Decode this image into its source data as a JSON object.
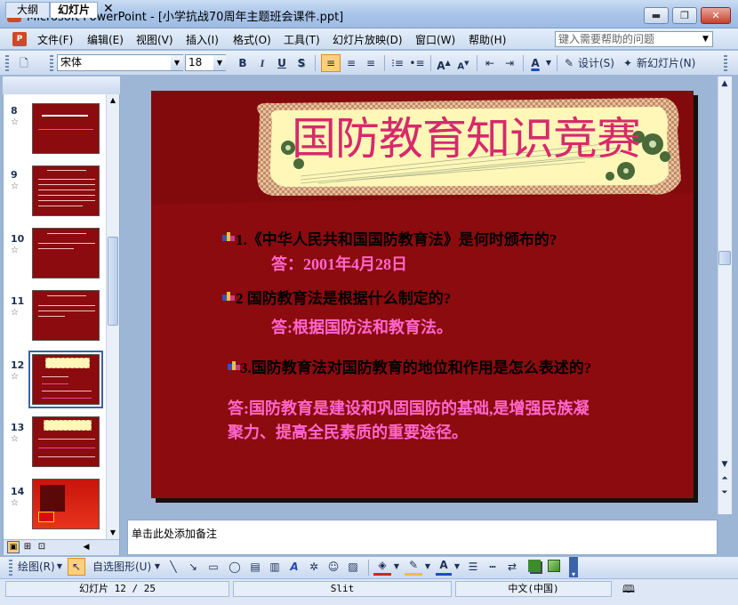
{
  "window": {
    "title": "Microsoft PowerPoint - [小学抗战70周年主题班会课件.ppt]",
    "app_icon": "P",
    "controls": {
      "minimize": "▬",
      "restore": "❐",
      "close": "✕"
    }
  },
  "menu": {
    "items": [
      "文件(F)",
      "编辑(E)",
      "视图(V)",
      "插入(I)",
      "格式(O)",
      "工具(T)",
      "幻灯片放映(D)",
      "窗口(W)",
      "帮助(H)"
    ],
    "help_placeholder": "键入需要帮助的问题"
  },
  "format_toolbar": {
    "font_name": "宋体",
    "font_size": "18",
    "bold": "B",
    "italic": "I",
    "underline": "U",
    "shadow": "S",
    "font_color_glyph": "A",
    "design_label": "设计(S)",
    "new_slide_label": "新幻灯片(N)"
  },
  "left_panel": {
    "tabs": [
      "大纲",
      "幻灯片"
    ],
    "close": "✕",
    "slides": [
      {
        "num": "8"
      },
      {
        "num": "9"
      },
      {
        "num": "10"
      },
      {
        "num": "11"
      },
      {
        "num": "12",
        "selected": true
      },
      {
        "num": "13"
      },
      {
        "num": "14"
      }
    ]
  },
  "slide": {
    "title": "国防教育知识竞赛",
    "q1": "1.《中华人民共和国国防教育法》是何时颁布的?",
    "a1": "答：2001年4月28日",
    "q2": "2 国防教育法是根据什么制定的?",
    "a2": "答:根据国防法和教育法。",
    "q3": "3.国防教育法对国防教育的地位和作用是怎么表述的?",
    "a3_line1": "答:国防教育是建设和巩固国防的基础,是增强民族凝",
    "a3_line2": "聚力、提高全民素质的重要途径。",
    "colors": {
      "background": "#8b0b0e",
      "title": "#d62a6b",
      "answer": "#ff66cc",
      "banner": "#fff7b8"
    }
  },
  "notes": {
    "placeholder": "单击此处添加备注"
  },
  "draw_toolbar": {
    "draw_label": "绘图(R)",
    "autoshape_label": "自选图形(U)"
  },
  "status": {
    "slide_info": "幻灯片 12 / 25",
    "design": "Slit",
    "language": "中文(中国)"
  }
}
